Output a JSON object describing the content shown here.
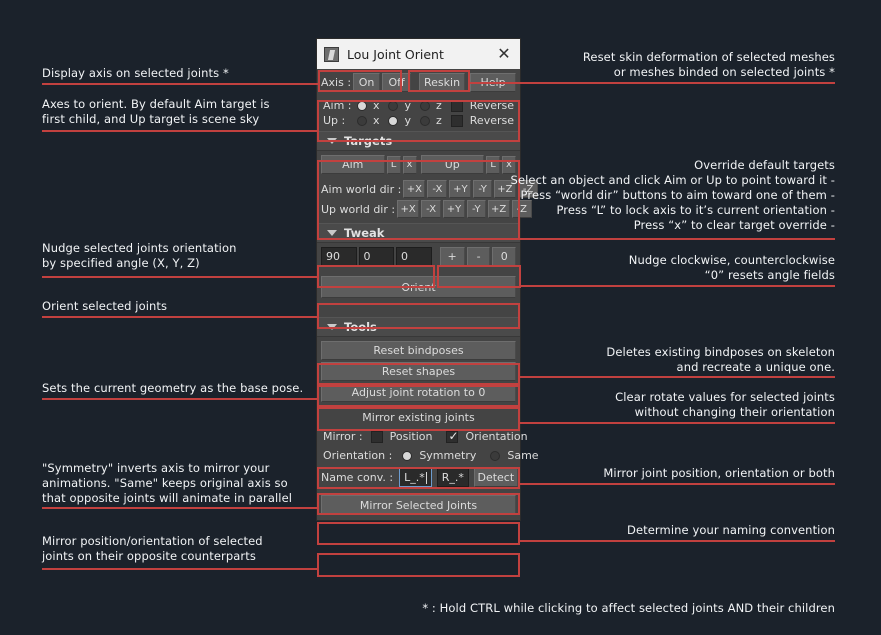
{
  "window": {
    "title": "Lou Joint Orient",
    "icon": "joint-icon",
    "close_label": "✕"
  },
  "toolbar": {
    "axis_label": "Axis :",
    "on_label": "On",
    "off_label": "Off",
    "reskin_label": "Reskin",
    "help_label": "Help"
  },
  "axes": {
    "aim_label": "Aim :",
    "up_label": "Up :",
    "x_label": "x",
    "y_label": "y",
    "z_label": "z",
    "reverse_label": "Reverse",
    "aim_selected": "x",
    "up_selected": "y",
    "aim_reverse_checked": false,
    "up_reverse_checked": false
  },
  "targets": {
    "section_label": "Targets",
    "aim_button": "Aim",
    "up_button": "Up",
    "lock_label": "L",
    "clear_label": "x",
    "aim_world_label": "Aim world dir :",
    "up_world_label": "Up world dir :",
    "dirs": [
      "+X",
      "-X",
      "+Y",
      "-Y",
      "+Z",
      "-Z"
    ]
  },
  "tweak": {
    "section_label": "Tweak",
    "x_value": "90",
    "y_value": "0",
    "z_value": "0",
    "plus_label": "+",
    "minus_label": "-",
    "zero_label": "0",
    "orient_label": "Orient"
  },
  "tools": {
    "section_label": "Tools",
    "reset_bindposes": "Reset bindposes",
    "reset_shapes": "Reset shapes",
    "adjust_joint_rotation": "Adjust joint rotation to 0",
    "mirror_header": "Mirror existing joints",
    "mirror_label": "Mirror :",
    "position_label": "Position",
    "orientation_label": "Orientation",
    "position_checked": false,
    "orientation_checked": true,
    "orientation_row_label": "Orientation :",
    "symmetry_label": "Symmetry",
    "same_label": "Same",
    "orientation_mode": "Symmetry",
    "name_conv_label": "Name conv. :",
    "name_left_value": "L_.*",
    "name_right_value": "R_.*",
    "detect_label": "Detect",
    "mirror_selected_joints": "Mirror Selected Joints"
  },
  "annotations": {
    "display_axis": "Display axis on selected joints *",
    "axes_to_orient": "Axes to orient. By default Aim target is\nfirst child, and Up target is scene sky",
    "nudge_orientation": "Nudge selected joints orientation\nby specified angle (X, Y, Z)",
    "orient_selected": "Orient selected joints",
    "base_pose": "Sets the current geometry as the base pose.",
    "symmetry_explain": "\"Symmetry\" inverts axis to mirror your\nanimations. \"Same\" keeps original axis so\nthat opposite joints will animate in parallel",
    "mirror_position_orientation": "Mirror position/orientation of selected\njoints on their opposite counterparts",
    "reset_skin": "Reset skin deformation of selected meshes\nor meshes binded on selected joints *",
    "override_targets": "Override default targets\nSelect an object and click Aim or Up to point toward it -\nPress “world dir” buttons to aim toward one of them -\nPress “L” to lock axis to it’s current orientation -\nPress “x” to clear target override -",
    "nudge_clockwise": "Nudge clockwise, counterclockwise\n“0” resets angle fields",
    "delete_bindposes": "Deletes existing bindposes on skeleton\nand recreate a unique one.",
    "clear_rotate": "Clear rotate values for selected joints\nwithout changing their orientation",
    "mirror_joint": "Mirror joint position, orientation or both",
    "naming_convention": "Determine your naming convention",
    "footnote": "* : Hold CTRL while clicking to affect selected joints AND their children"
  },
  "colors": {
    "accent": "#c2413f",
    "background": "#1b222b",
    "panel": "#444444",
    "button": "#5d5d5d",
    "field": "#2a2a2a"
  }
}
